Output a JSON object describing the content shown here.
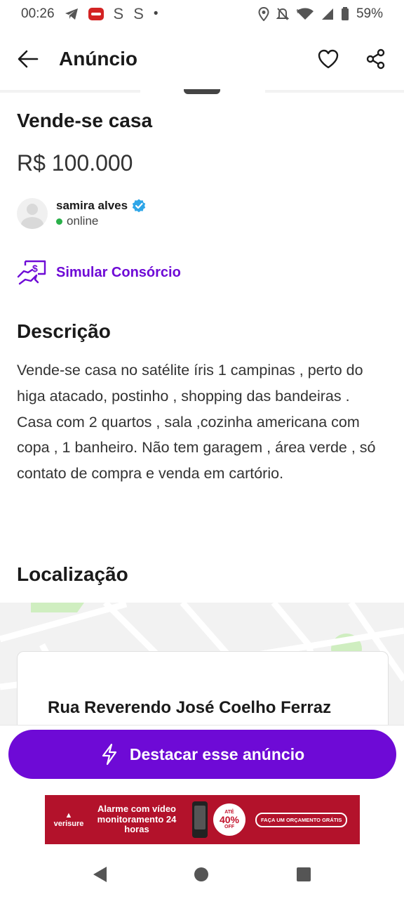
{
  "status_bar": {
    "time": "00:26",
    "s1": "S",
    "s2": "S",
    "dot": "•",
    "battery": "59%",
    "icons": [
      "telegram-icon",
      "youtube-icon",
      "location-icon",
      "mute-icon",
      "wifi-icon",
      "signal-icon",
      "battery-icon"
    ]
  },
  "app_bar": {
    "title": "Anúncio",
    "icons": [
      "back-arrow-icon",
      "heart-icon",
      "share-icon"
    ]
  },
  "ad": {
    "title": "Vende-se casa",
    "price": "R$ 100.000"
  },
  "seller": {
    "name": "samira alves",
    "status": "online",
    "verified_color": "#2ea6e8",
    "online_color": "#2ab04a"
  },
  "simular": {
    "label": "Simular Consórcio"
  },
  "description": {
    "heading": "Descrição",
    "text": "Vende-se casa no satélite íris 1 campinas , perto do higa atacado, postinho , shopping das bandeiras . Casa com 2 quartos , sala ,cozinha americana com copa , 1 banheiro. Não tem garagem , área verde , só contato de compra e venda em cartório."
  },
  "location": {
    "heading": "Localização",
    "address": "Rua Reverendo José Coelho Ferraz"
  },
  "cta": {
    "label": "Destacar esse anúncio"
  },
  "banner": {
    "brand": "verisure",
    "headline": "Alarme com vídeo monitoramento 24 horas",
    "badge_prefix": "ATÉ",
    "badge_value": "40%",
    "badge_suffix": "OFF",
    "cta": "FAÇA UM ORÇAMENTO GRÁTIS"
  },
  "accent_color": "#6e0ad6",
  "nav_bar": {
    "icons": [
      "nav-back-icon",
      "nav-home-icon",
      "nav-recents-icon"
    ]
  }
}
